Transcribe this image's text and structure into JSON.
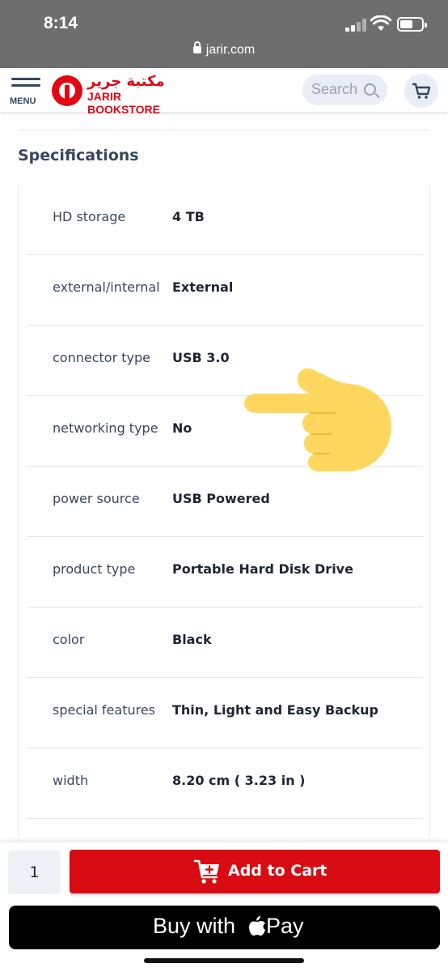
{
  "status_bar": {
    "time": "8:14"
  },
  "browser": {
    "url": "jarir.com"
  },
  "header": {
    "menu_label": "MENU",
    "logo_arabic": "مكتبة جرير",
    "logo_latin": "JARIR BOOKSTORE",
    "search_placeholder": "Search"
  },
  "specifications": {
    "title": "Specifications",
    "rows": [
      {
        "label": "HD storage",
        "value": "4 TB"
      },
      {
        "label": "external/internal",
        "value": "External"
      },
      {
        "label": "connector type",
        "value": "USB 3.0"
      },
      {
        "label": "networking type",
        "value": "No"
      },
      {
        "label": "power source",
        "value": "USB Powered"
      },
      {
        "label": "product type",
        "value": "Portable Hard Disk Drive"
      },
      {
        "label": "color",
        "value": "Black"
      },
      {
        "label": "special features",
        "value": "Thin, Light and Easy Backup"
      },
      {
        "label": "width",
        "value": "8.20 cm ( 3.23 in )"
      }
    ]
  },
  "purchase": {
    "quantity": "1",
    "add_to_cart_label": "Add to Cart",
    "apple_pay_prefix": "Buy with",
    "apple_pay_suffix": "Pay"
  },
  "colors": {
    "brand_red": "#d90b12",
    "text_dark": "#1f2533",
    "label_text": "#3a4660",
    "hand_emoji": "#ffd75e"
  },
  "icons": [
    "lock-icon",
    "hamburger-menu-icon",
    "search-icon",
    "cart-icon",
    "apple-logo-icon",
    "pointing-hand-emoji"
  ]
}
